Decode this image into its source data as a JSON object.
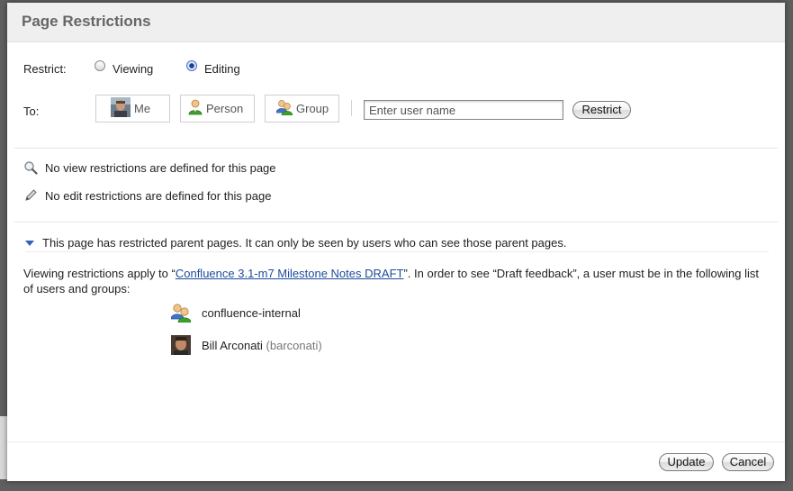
{
  "dialog": {
    "title": "Page Restrictions"
  },
  "restrict": {
    "label": "Restrict:",
    "options": [
      {
        "label": "Viewing",
        "checked": false
      },
      {
        "label": "Editing",
        "checked": true
      }
    ]
  },
  "to": {
    "label": "To:",
    "buttons": {
      "me": "Me",
      "person": "Person",
      "group": "Group"
    },
    "input_placeholder": "Enter user name",
    "restrict_button": "Restrict"
  },
  "status": {
    "view": "No view restrictions are defined for this page",
    "edit": "No edit restrictions are defined for this page"
  },
  "parent_note": "This page has restricted parent pages. It can only be seen by users who can see those parent pages.",
  "explanation": {
    "prefix": "Viewing restrictions apply to “",
    "link": "Confluence 3.1-m7 Milestone Notes DRAFT",
    "suffix": "”. In order to see “Draft feedback”, a user must be in the following list of users and groups:"
  },
  "entries": [
    {
      "type": "group",
      "name": "confluence-internal",
      "username": ""
    },
    {
      "type": "user",
      "name": "Bill Arconati",
      "username": "(barconati)"
    }
  ],
  "footer": {
    "update": "Update",
    "cancel": "Cancel"
  },
  "colors": {
    "link": "#1d4b9b",
    "header_bg": "#efefef",
    "title": "#666666",
    "triangle": "#2f66b3"
  }
}
